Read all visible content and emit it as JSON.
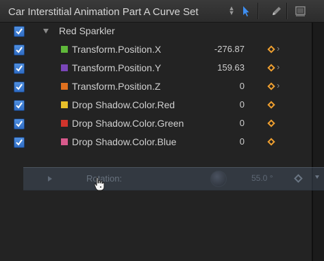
{
  "header": {
    "curve_set_title": "Car Interstitial Animation Part A Curve Set",
    "stepper_icon": "up-down-stepper",
    "icons": [
      "arrow-pointer-icon",
      "pen-icon",
      "frame-icon"
    ]
  },
  "group": {
    "label": "Red Sparkler",
    "checked": true
  },
  "parameters": [
    {
      "label": "Transform.Position.X",
      "value": "-276.87",
      "color": "#5fb83a",
      "checked": true,
      "has_arrow": true
    },
    {
      "label": "Transform.Position.Y",
      "value": "159.63",
      "color": "#7a46b8",
      "checked": true,
      "has_arrow": true
    },
    {
      "label": "Transform.Position.Z",
      "value": "0",
      "color": "#e0701e",
      "checked": true,
      "has_arrow": true
    },
    {
      "label": "Drop Shadow.Color.Red",
      "value": "0",
      "color": "#e8c02a",
      "checked": true,
      "has_arrow": false
    },
    {
      "label": "Drop Shadow.Color.Green",
      "value": "0",
      "color": "#d0342c",
      "checked": true,
      "has_arrow": false
    },
    {
      "label": "Drop Shadow.Color.Blue",
      "value": "0",
      "color": "#d85a8c",
      "checked": true,
      "has_arrow": false
    }
  ],
  "drag_ghost": {
    "label": "Rotation:",
    "value": "55.0 °"
  },
  "colors": {
    "keyframe": "#f0a030",
    "checkbox": "#3a7bd5"
  }
}
